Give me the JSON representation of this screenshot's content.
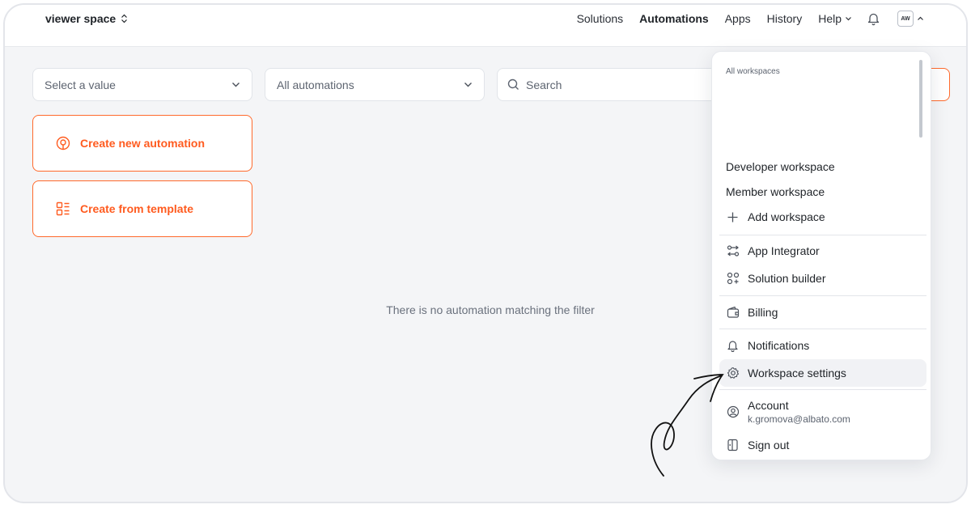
{
  "header": {
    "workspace_name": "viewer space",
    "nav": [
      "Solutions",
      "Automations",
      "Apps",
      "History",
      "Help"
    ],
    "active_nav": "Automations",
    "avatar_initials": "AW"
  },
  "filters": {
    "value_select": "Select a value",
    "automation_select": "All automations",
    "search_placeholder": "Search"
  },
  "actions": {
    "create_new": "Create new automation",
    "create_from_template": "Create from template"
  },
  "empty_state": "There is no automation matching the filter",
  "dropdown": {
    "heading": "All workspaces",
    "workspaces": [
      "Developer workspace",
      "Member workspace"
    ],
    "add_workspace": "Add workspace",
    "app_integrator": "App Integrator",
    "solution_builder": "Solution builder",
    "billing": "Billing",
    "notifications": "Notifications",
    "workspace_settings": "Workspace settings",
    "account": "Account",
    "account_email": "k.gromova@albato.com",
    "sign_out": "Sign out"
  },
  "colors": {
    "accent": "#ff5b1f",
    "page_bg": "#f4f5f7"
  }
}
